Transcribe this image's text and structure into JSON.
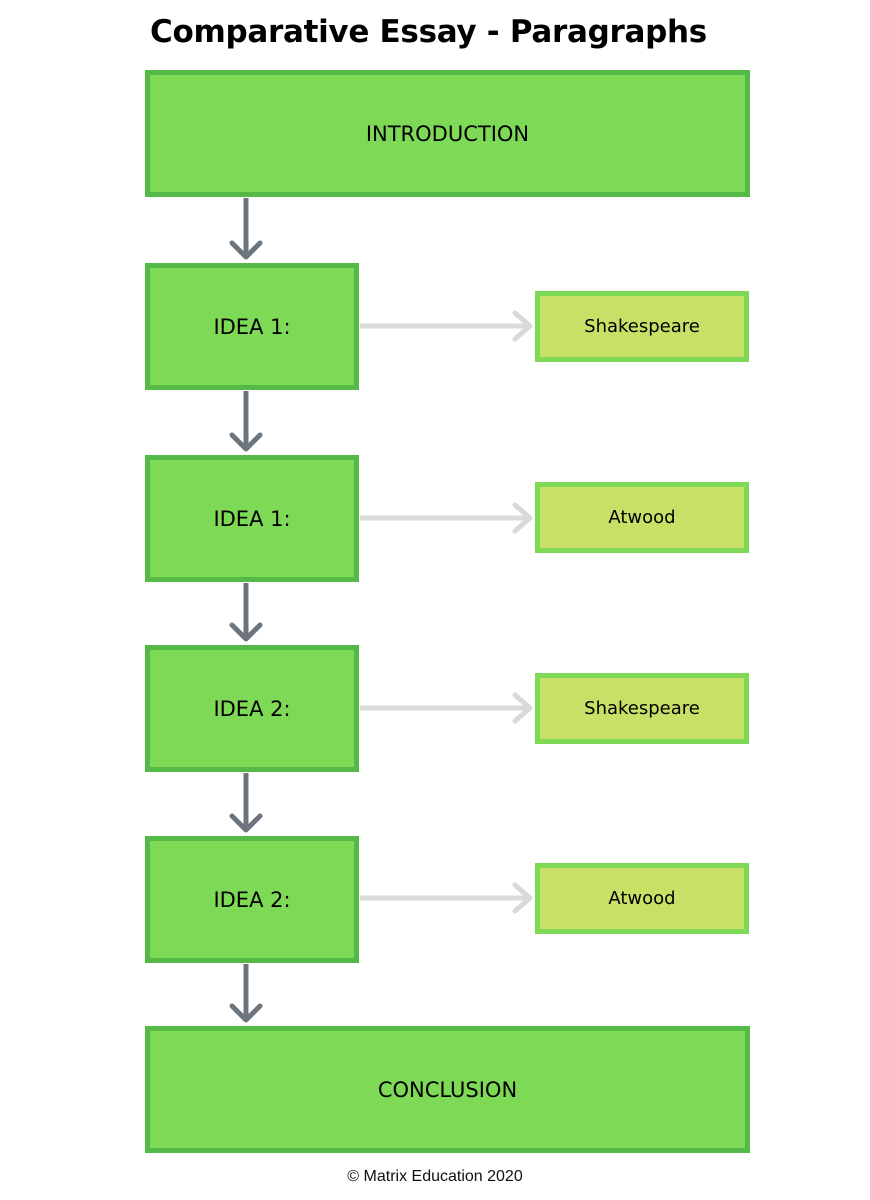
{
  "title": "Comparative Essay - Paragraphs",
  "nodes": {
    "intro": "INTRODUCTION",
    "ideas": [
      {
        "label": "IDEA 1:",
        "text": "Shakespeare"
      },
      {
        "label": "IDEA 1:",
        "text": "Atwood"
      },
      {
        "label": "IDEA 2:",
        "text": "Shakespeare"
      },
      {
        "label": "IDEA 2:",
        "text": "Atwood"
      }
    ],
    "conclusion": "CONCLUSION"
  },
  "colors": {
    "main_fill": "#7ed957",
    "main_border": "#55b947",
    "side_fill": "#c9e067",
    "side_border": "#7ed957",
    "flow_arrow": "#6c757d",
    "side_arrow": "#d9d9d9"
  },
  "footer": "© Matrix Education 2020"
}
